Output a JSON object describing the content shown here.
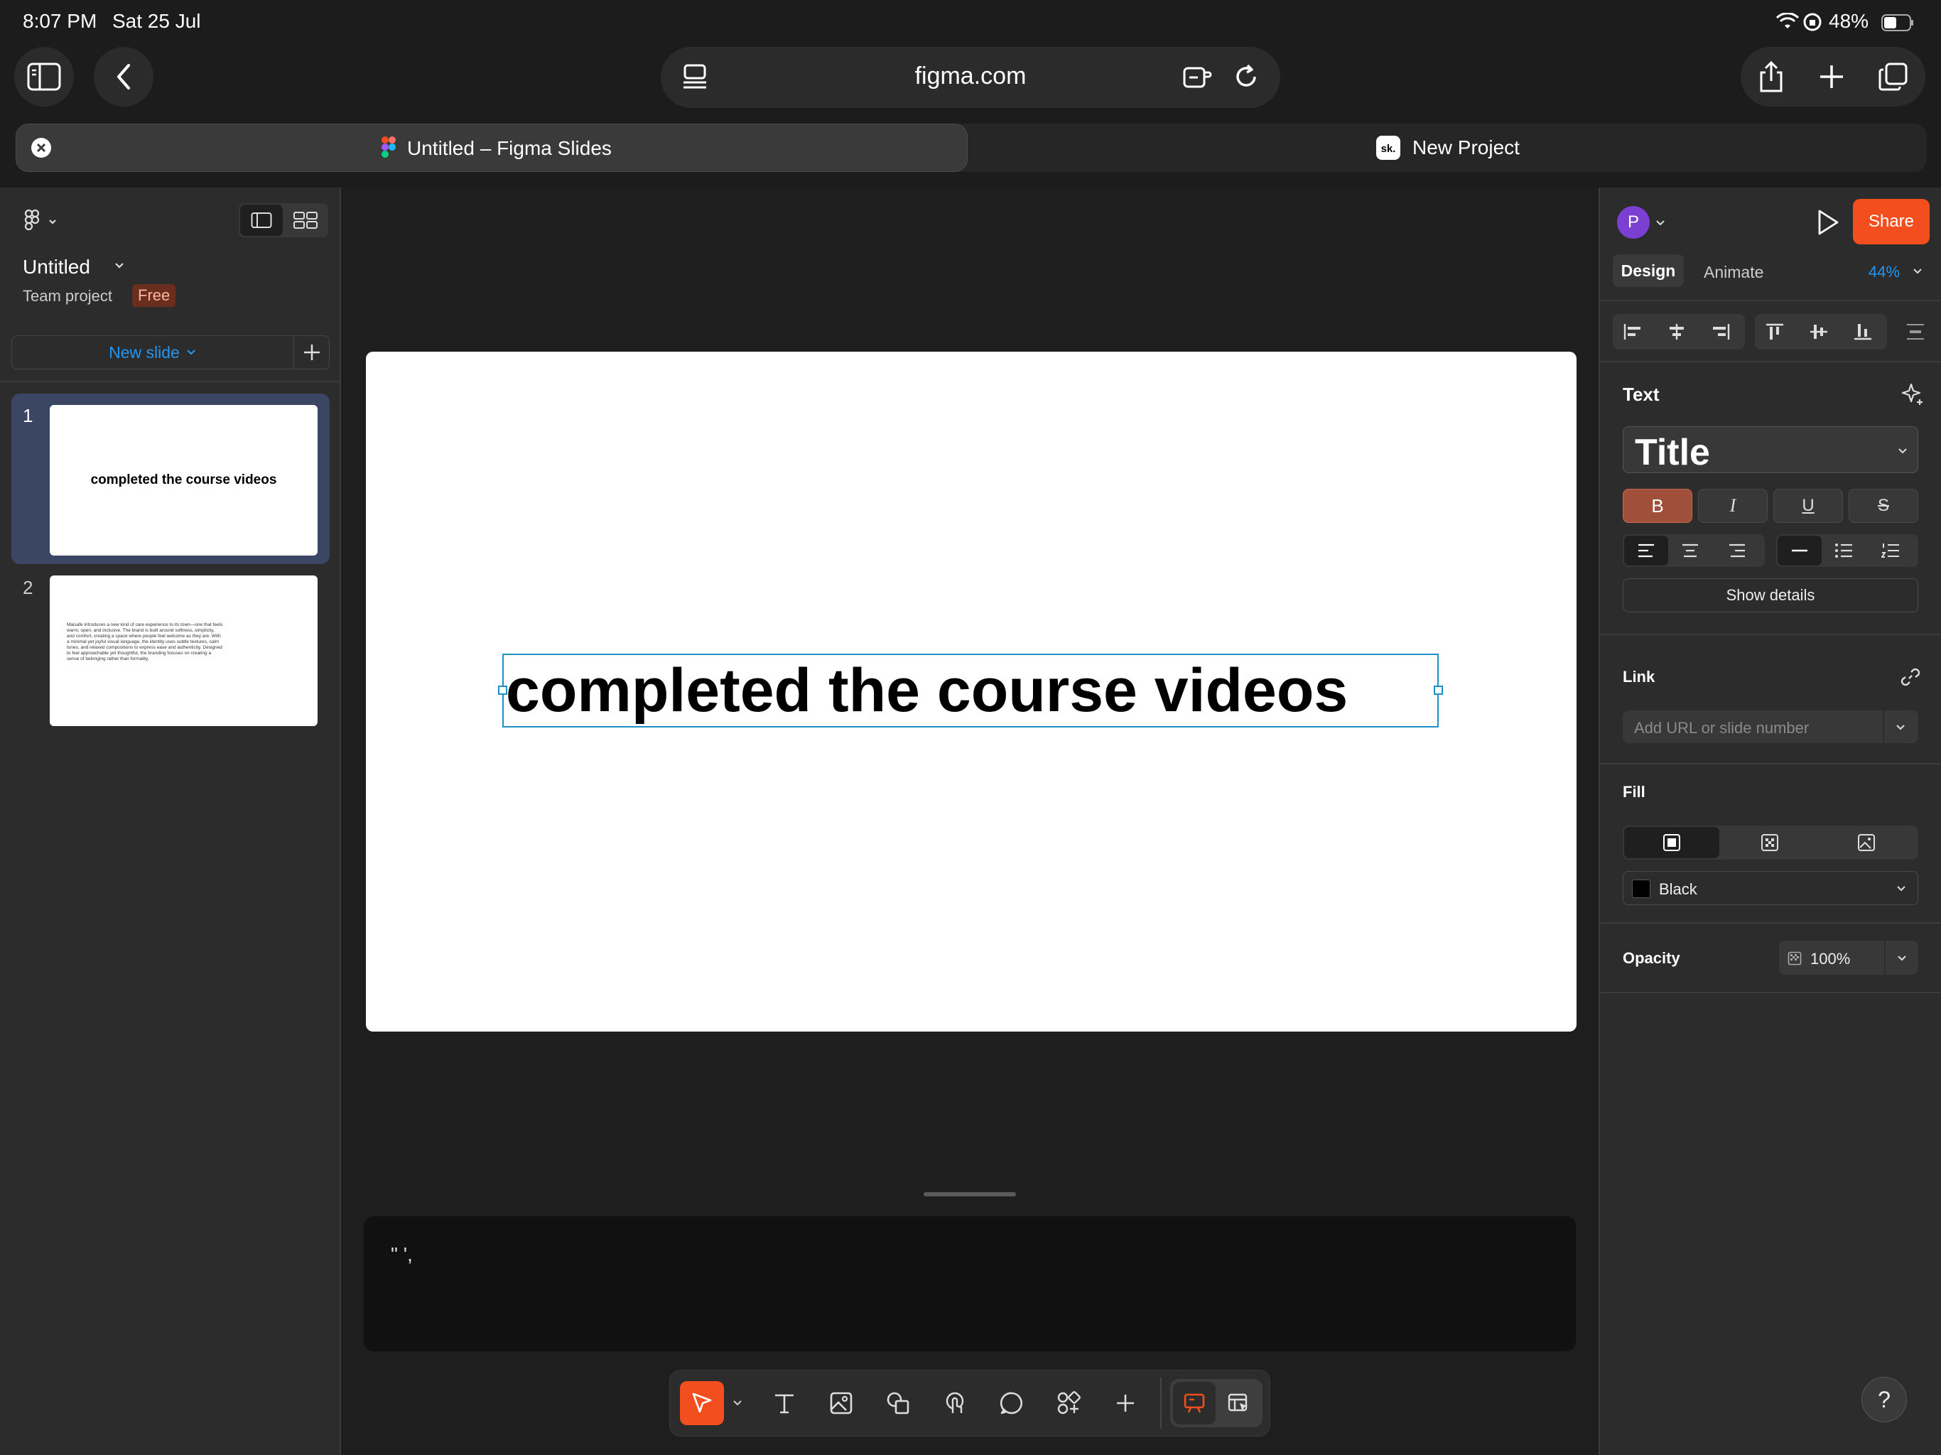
{
  "status": {
    "time": "8:07 PM",
    "date": "Sat 25 Jul",
    "battery": "48%"
  },
  "browser": {
    "url": "figma.com"
  },
  "tabs": [
    {
      "title": "Untitled – Figma Slides"
    },
    {
      "title": "New Project"
    }
  ],
  "left": {
    "file_title": "Untitled",
    "team": "Team project",
    "plan_badge": "Free",
    "new_slide_label": "New slide",
    "slides": [
      {
        "number": "1",
        "preview": "completed the course videos"
      },
      {
        "number": "2",
        "preview": "Maisafe introduces a new kind of care experience to its town—one that feels warm, open, and inclusive. The brand is built around softness, simplicity, and comfort, creating a space where people feel welcome as they are. With a minimal yet joyful visual language, the identity uses subtle textures, calm tones, and relaxed compositions to express ease and authenticity. Designed to feel approachable yet thoughtful, the branding focuses on creating a sense of belonging rather than formality."
      }
    ]
  },
  "canvas": {
    "title_text": "completed the course videos",
    "notes_text": "\" ',"
  },
  "right": {
    "avatar_initial": "P",
    "share_label": "Share",
    "tab_design": "Design",
    "tab_animate": "Animate",
    "zoom": "44%",
    "text_section": "Text",
    "text_style": "Title",
    "bold_label": "B",
    "italic_label": "I",
    "underline_label": "U",
    "strike_label": "S",
    "show_details": "Show details",
    "link_section": "Link",
    "link_placeholder": "Add URL or slide number",
    "fill_section": "Fill",
    "fill_color_name": "Black",
    "opacity_section": "Opacity",
    "opacity_value": "100%",
    "help": "?"
  },
  "colors": {
    "accent": "#f24e1e",
    "link_blue": "#2196f3",
    "selection": "#1e90c8"
  }
}
